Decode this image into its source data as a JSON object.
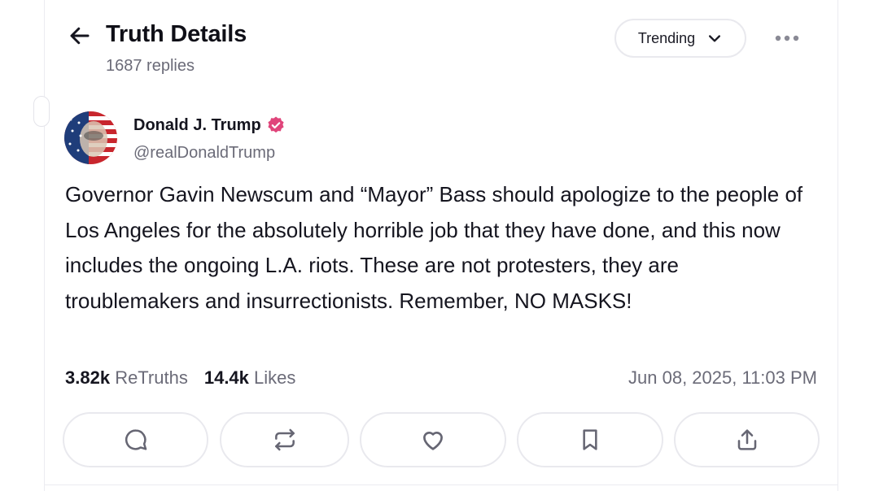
{
  "header": {
    "title": "Truth Details",
    "replies": "1687 replies",
    "sort_label": "Trending"
  },
  "post": {
    "author_name": "Donald J. Trump",
    "handle": "@realDonaldTrump",
    "text": "Governor Gavin Newscum and “Mayor” Bass should apologize to the people of Los Angeles for the absolutely horrible job that they have done, and this now includes the ongoing L.A. riots. These are not protesters, they are troublemakers and insurrectionists. Remember, NO MASKS!",
    "retruths_count": "3.82k",
    "retruths_label": "ReTruths",
    "likes_count": "14.4k",
    "likes_label": "Likes",
    "timestamp": "Jun 08, 2025, 11:03 PM"
  },
  "icons": {
    "back": "arrow-left-icon",
    "sort": "chevron-down-icon",
    "more": "more-horizontal-icon",
    "verified": "verified-badge-icon",
    "reply": "comment-icon",
    "retruth": "repost-icon",
    "like": "heart-icon",
    "bookmark": "bookmark-icon",
    "share": "share-icon"
  },
  "colors": {
    "verified": "#e0457b",
    "text": "#15151f",
    "muted": "#6b6b78",
    "border": "#e9e9ee"
  }
}
